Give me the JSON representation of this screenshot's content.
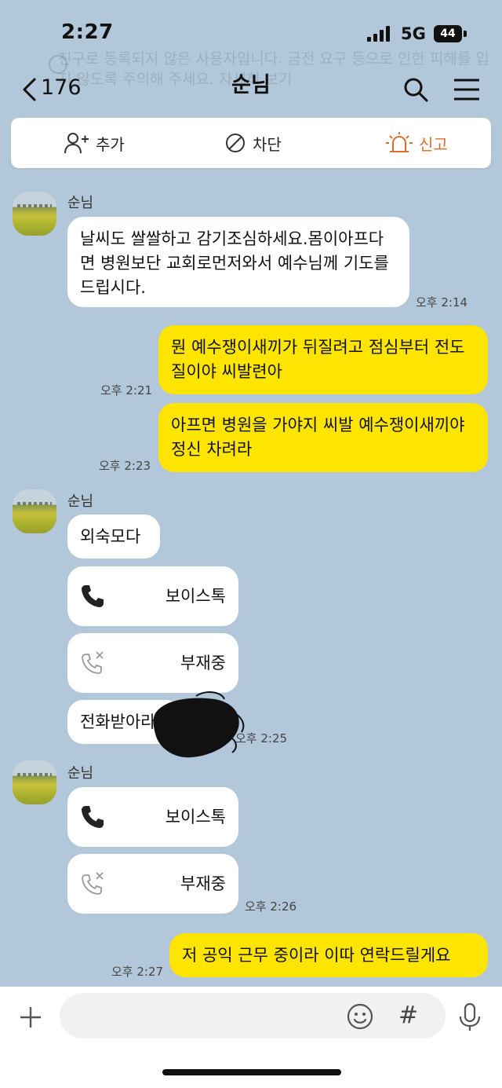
{
  "status_bar": {
    "time": "2:27",
    "network": "5G",
    "battery": "44"
  },
  "warning_banner": {
    "text": "친구로 등록되지 않은 사용자입니다. 금전 요구 등으로 인한 피해를 입지 않도록 주의해 주세요. 자세히 보기"
  },
  "header": {
    "back_count": "176",
    "title": "순님"
  },
  "action_bar": {
    "add_label": "추가",
    "block_label": "차단",
    "report_label": "신고",
    "report_color": "#d8702c"
  },
  "messages": {
    "sender_name": "순님",
    "m1": {
      "text": "날씨도 쌀쌀하고 감기조심하세요.몸이아프다면 병원보단 교회로먼저와서 예수님께 기도를드립시다.",
      "time": "오후 2:14"
    },
    "m2": {
      "text": "뭔 예수쟁이새끼가 뒤질려고 점심부터 전도질이야 씨발련아",
      "time": "오후 2:21"
    },
    "m3": {
      "text": "아프면 병원을 가야지 씨발 예수쟁이새끼야 정신 차려라",
      "time": "오후 2:23"
    },
    "m4": {
      "text": "외숙모다"
    },
    "m5": {
      "label": "보이스톡"
    },
    "m6": {
      "label": "부재중"
    },
    "m7": {
      "text": "전화받아라",
      "time": "오후 2:25"
    },
    "m8": {
      "label": "보이스톡"
    },
    "m9": {
      "label": "부재중",
      "time": "오후 2:26"
    },
    "m10": {
      "text": "저 공익 근무 중이라 이따 연락드릴게요",
      "time": "오후 2:27"
    }
  },
  "input_bar": {
    "placeholder": "",
    "hash_symbol": "#"
  },
  "colors": {
    "background": "#b2c7d9",
    "outgoing_bubble": "#fee500",
    "incoming_bubble": "#ffffff"
  },
  "icons": [
    "chevron-left-icon",
    "search-icon",
    "menu-icon",
    "add-friend-icon",
    "block-icon",
    "siren-icon",
    "phone-icon",
    "missed-call-icon",
    "plus-icon",
    "emoji-icon",
    "hash-icon",
    "mic-icon"
  ]
}
